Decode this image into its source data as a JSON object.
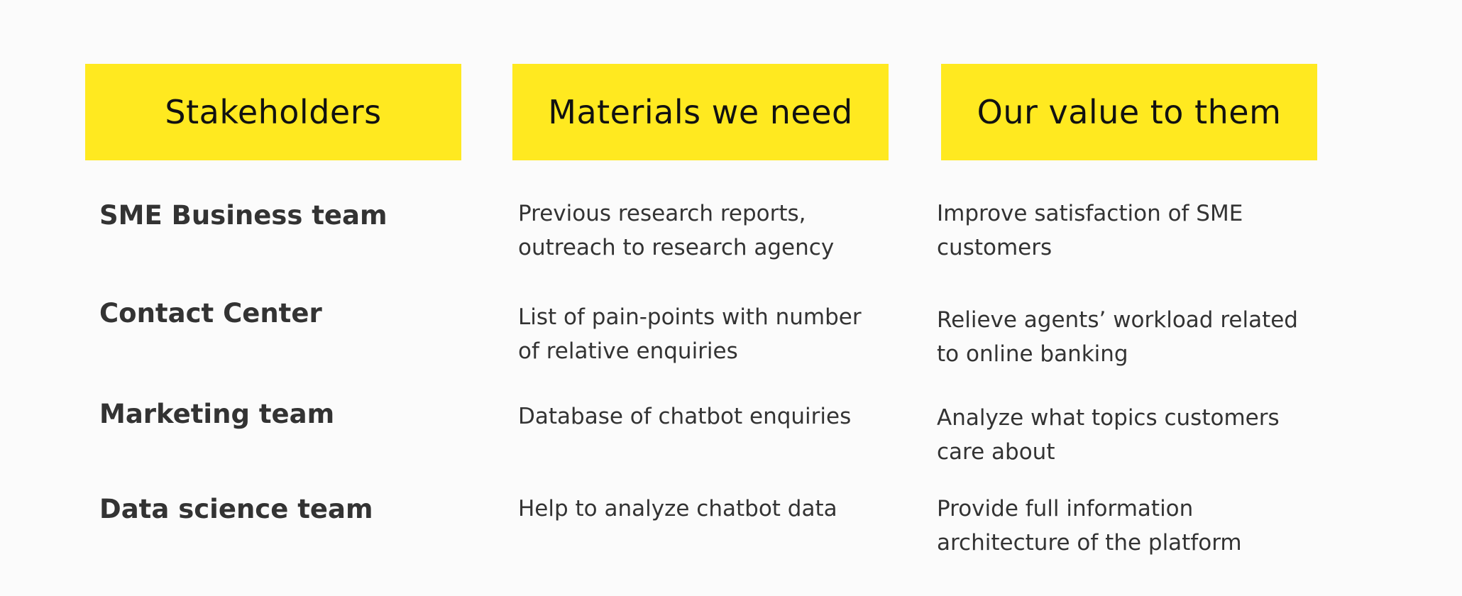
{
  "headers": [
    "Stakeholders",
    "Materials we need",
    "Our value to them"
  ],
  "rows": [
    {
      "stakeholder": "SME Business team",
      "materials": "Previous research reports,\noutreach to research agency",
      "value": "Improve satisfaction of SME\ncustomers"
    },
    {
      "stakeholder": "Contact Center",
      "materials": "List of pain-points with number\nof relative enquiries",
      "value": "Relieve agents’ workload related\nto online banking"
    },
    {
      "stakeholder": "Marketing team",
      "materials": "Database of chatbot enquiries",
      "value": "Analyze what topics customers\ncare about"
    },
    {
      "stakeholder": "Data science team",
      "materials": "Help to analyze chatbot data",
      "value": "Provide full information\narchitecture of the platform"
    }
  ],
  "colors": {
    "header_background": "#ffe920",
    "page_background": "#fbfbfb",
    "text": "#333333"
  }
}
